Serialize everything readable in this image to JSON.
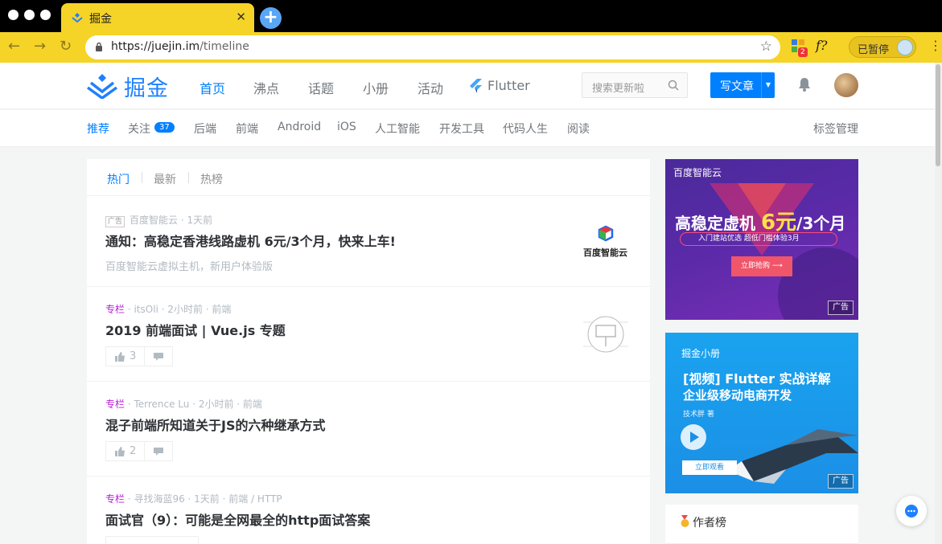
{
  "browser": {
    "tab_title": "掘金",
    "url_host": "https://juejin.im",
    "url_path": "/timeline",
    "ext_badge": "2",
    "ext2_label": "f?",
    "profile_status": "已暂停"
  },
  "site": {
    "logo_text": "掘金",
    "nav": [
      "首页",
      "沸点",
      "话题",
      "小册",
      "活动"
    ],
    "flutter_label": "Flutter",
    "search_placeholder": "搜索更新啦",
    "write_label": "写文章",
    "accent_color": "#007fff"
  },
  "subnav": {
    "items": [
      "推荐",
      "关注",
      "后端",
      "前端",
      "Android",
      "iOS",
      "人工智能",
      "开发工具",
      "代码人生",
      "阅读"
    ],
    "follow_count": "37",
    "tag_management": "标签管理"
  },
  "feed": {
    "tabs": [
      "热门",
      "最新",
      "热榜"
    ],
    "entries": [
      {
        "ad_tag": "广告",
        "meta": "百度智能云 · 1天前",
        "title": "通知：高稳定香港线路虚机 6元/3个月，快来上车!",
        "subtitle": "百度智能云虚拟主机，新用户体验版",
        "thumb_text": "百度智能云"
      },
      {
        "column": "专栏",
        "meta": " · itsOli · 2小时前 · 前端",
        "title": "2019 前端面试 | Vue.js 专题",
        "likes": "3"
      },
      {
        "column": "专栏",
        "meta": " · Terrence Lu · 2小时前 · 前端",
        "title": "混子前端所知道关于JS的六种继承方式",
        "likes": "2"
      },
      {
        "column": "专栏",
        "meta": " · 寻找海蓝96 · 1天前 · 前端 / HTTP",
        "title": "面试官（9）：可能是全网最全的http面试答案"
      }
    ]
  },
  "sidebar": {
    "ad1": {
      "brand": "百度智能云",
      "headline_a": "高稳定虚机",
      "headline_price": "6元",
      "headline_b": "/3个月",
      "pill": "入门建站优选  超低门槛体验3月",
      "button": "立即抢购 ⟶",
      "ad_label": "广告"
    },
    "ad2": {
      "brand": "掘金小册",
      "line1": "[视频] Flutter 实战详解",
      "line2": "企业级移动电商开发",
      "author": "技术胖 著",
      "button": "立即观看",
      "ad_label": "广告"
    },
    "author_board": "作者榜"
  }
}
